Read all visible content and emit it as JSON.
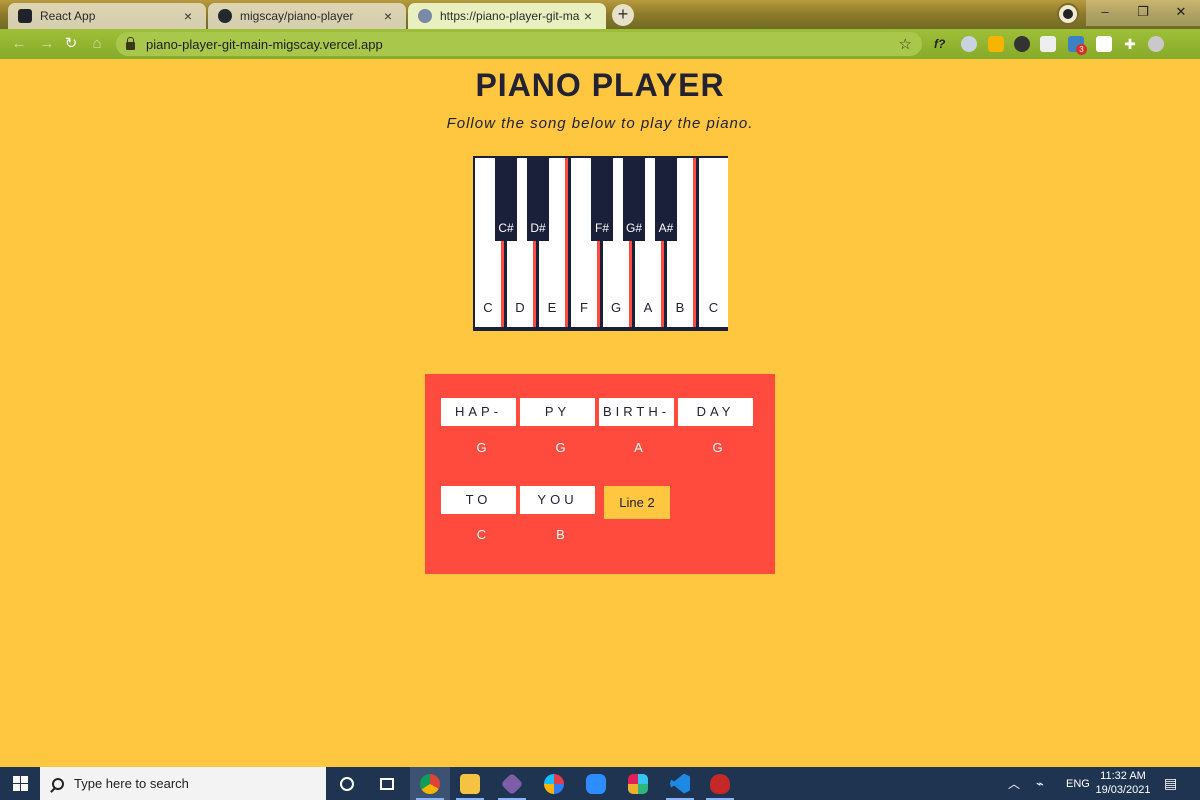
{
  "browser": {
    "tabs": [
      {
        "title": "React App",
        "icon": "react-icon",
        "active": false
      },
      {
        "title": "migscay/piano-player",
        "icon": "github-icon",
        "active": false
      },
      {
        "title": "https://piano-player-git-main-m",
        "icon": "globe-icon",
        "active": true
      }
    ],
    "close_glyph": "×",
    "new_tab_glyph": "+",
    "window_controls": {
      "minimize": "–",
      "restore": "❐",
      "close": "✕"
    },
    "url": "piano-player-git-main-migscay.vercel.app",
    "bookmark_glyph": "☆",
    "ext_badge": "3"
  },
  "page": {
    "title": "PIANO PLAYER",
    "subtitle": "Follow the song below to play the piano.",
    "piano": {
      "white_keys": [
        "C",
        "D",
        "E",
        "F",
        "G",
        "A",
        "B",
        "C"
      ],
      "black_keys": [
        "C#",
        "D#",
        "F#",
        "G#",
        "A#"
      ]
    },
    "song": {
      "line1": [
        {
          "lyric": "HAP-",
          "note": "G"
        },
        {
          "lyric": "PY",
          "note": "G"
        },
        {
          "lyric": "BIRTH-",
          "note": "A"
        },
        {
          "lyric": "DAY",
          "note": "G"
        }
      ],
      "line2": [
        {
          "lyric": "TO",
          "note": "C"
        },
        {
          "lyric": "YOU",
          "note": "B"
        }
      ],
      "next_button": "Line 2"
    }
  },
  "taskbar": {
    "search_placeholder": "Type here to search",
    "language": "ENG",
    "time": "11:32 AM",
    "date": "19/03/2021"
  },
  "colors": {
    "background": "#ffc63f",
    "card": "#ff4b3e",
    "piano_dark": "#1a1f3a",
    "taskbar": "#1f3450"
  }
}
